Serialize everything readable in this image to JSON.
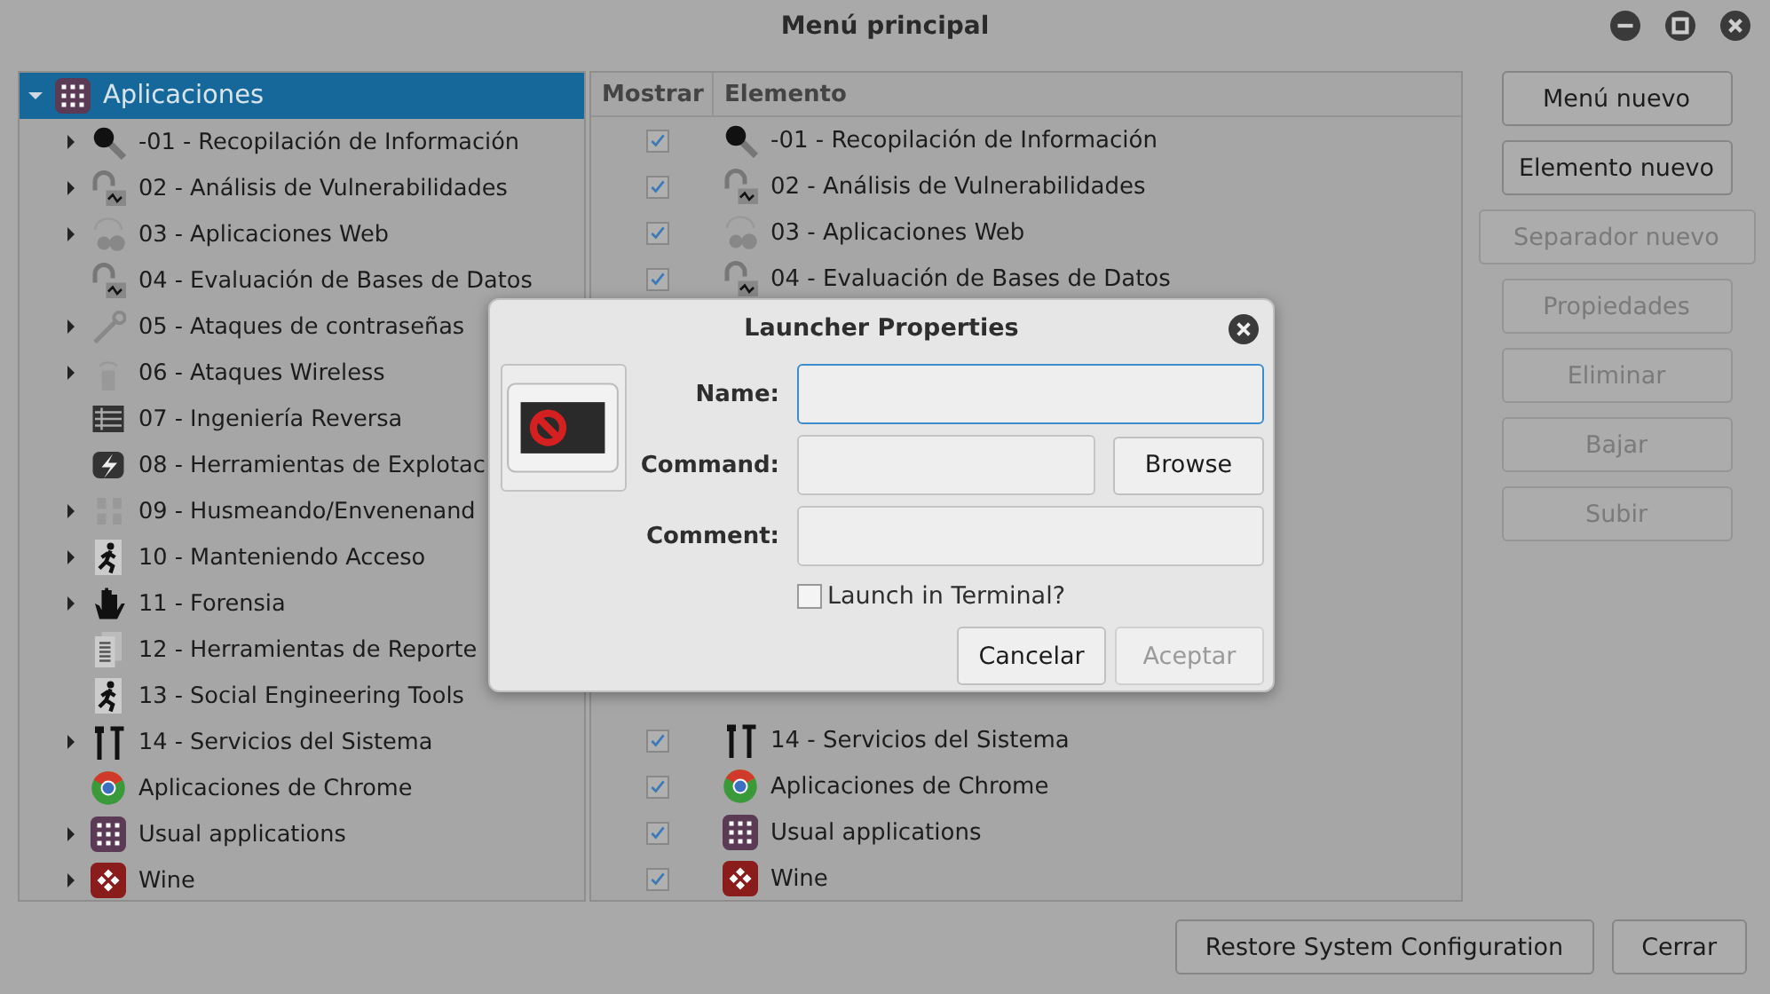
{
  "window": {
    "title": "Menú principal"
  },
  "tree": {
    "root": {
      "label": "Aplicaciones",
      "kind": "grid",
      "expanded": true,
      "selected": true,
      "children": [
        {
          "label": "-01 - Recopilación de Información",
          "kind": "search",
          "expandable": true
        },
        {
          "label": "02 - Análisis de Vulnerabilidades",
          "kind": "lock-chart",
          "expandable": true
        },
        {
          "label": "03 - Aplicaciones Web",
          "kind": "web-gear",
          "expandable": true
        },
        {
          "label": "04 - Evaluación de Bases de Datos",
          "kind": "lock-chart",
          "expandable": false
        },
        {
          "label": "05 - Ataques de contraseñas",
          "kind": "key",
          "expandable": true
        },
        {
          "label": "06 - Ataques Wireless",
          "kind": "wireless",
          "expandable": true
        },
        {
          "label": "07 - Ingeniería Reversa",
          "kind": "circuit",
          "expandable": false
        },
        {
          "label": "08 - Herramientas de Explotac",
          "kind": "bolt",
          "expandable": false
        },
        {
          "label": "09 - Husmeando/Envenenand",
          "kind": "network",
          "expandable": true
        },
        {
          "label": "10 - Manteniendo Acceso",
          "kind": "runner",
          "expandable": true
        },
        {
          "label": "11 - Forensia",
          "kind": "hand",
          "expandable": true
        },
        {
          "label": "12 - Herramientas de Reporte",
          "kind": "document",
          "expandable": false
        },
        {
          "label": "13 - Social Engineering Tools",
          "kind": "runner",
          "expandable": false
        },
        {
          "label": "14 - Servicios del Sistema",
          "kind": "tools",
          "expandable": true
        },
        {
          "label": "Aplicaciones de Chrome",
          "kind": "chrome",
          "expandable": false
        },
        {
          "label": "Usual applications",
          "kind": "grid",
          "expandable": true
        },
        {
          "label": "Wine",
          "kind": "wine",
          "expandable": true
        }
      ]
    }
  },
  "items": {
    "columns": [
      "Mostrar",
      "Elemento"
    ],
    "rows_top": [
      {
        "label": "-01 - Recopilación de Información",
        "kind": "search",
        "shown": true
      },
      {
        "label": "02 - Análisis de Vulnerabilidades",
        "kind": "lock-chart",
        "shown": true
      },
      {
        "label": "03 - Aplicaciones Web",
        "kind": "web-gear",
        "shown": true
      },
      {
        "label": "04 - Evaluación de Bases de Datos",
        "kind": "lock-chart",
        "shown": true
      }
    ],
    "rows_bottom": [
      {
        "label": "14 - Servicios del Sistema",
        "kind": "tools",
        "shown": true
      },
      {
        "label": "Aplicaciones de Chrome",
        "kind": "chrome",
        "shown": true
      },
      {
        "label": "Usual applications",
        "kind": "grid",
        "shown": true
      },
      {
        "label": "Wine",
        "kind": "wine",
        "shown": true
      }
    ]
  },
  "side_buttons": [
    {
      "label": "Menú nuevo",
      "disabled": false,
      "wide": false
    },
    {
      "label": "Elemento nuevo",
      "disabled": false,
      "wide": false
    },
    {
      "label": "Separador nuevo",
      "disabled": true,
      "wide": true
    },
    {
      "label": "Propiedades",
      "disabled": true,
      "wide": false
    },
    {
      "label": "Eliminar",
      "disabled": true,
      "wide": false
    },
    {
      "label": "Bajar",
      "disabled": true,
      "wide": false
    },
    {
      "label": "Subir",
      "disabled": true,
      "wide": false
    }
  ],
  "bottom_buttons": [
    {
      "label": "Restore System Configuration"
    },
    {
      "label": "Cerrar"
    }
  ],
  "dialog": {
    "title": "Launcher Properties",
    "name_label": "Name:",
    "command_label": "Command:",
    "comment_label": "Comment:",
    "browse": "Browse",
    "terminal": {
      "label": "Launch in Terminal?",
      "checked": false
    },
    "cancel": {
      "label": "Cancelar",
      "disabled": false
    },
    "accept": {
      "label": "Aceptar",
      "disabled": true
    }
  }
}
